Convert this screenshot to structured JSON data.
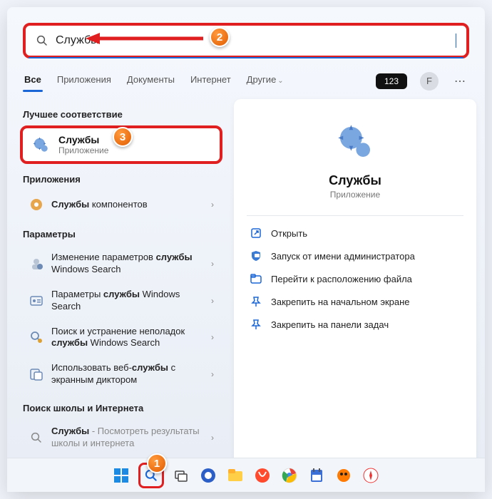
{
  "search": {
    "value": "Службы"
  },
  "tabs": [
    "Все",
    "Приложения",
    "Документы",
    "Интернет",
    "Другие"
  ],
  "active_tab": 0,
  "pill": "123",
  "avatar_initial": "F",
  "sections": {
    "best_match": "Лучшее соответствие",
    "apps": "Приложения",
    "settings": "Параметры",
    "web": "Поиск школы и Интернета"
  },
  "best": {
    "title": "Службы",
    "subtitle": "Приложение"
  },
  "app_items": [
    {
      "prefix": "Службы",
      "rest": " компонентов"
    }
  ],
  "setting_items": [
    {
      "text": "Изменение параметров <b>службы</b> Windows Search"
    },
    {
      "text": "Параметры <b>службы</b> Windows Search"
    },
    {
      "text": "Поиск и устранение неполадок <b>службы</b> Windows Search"
    },
    {
      "text": "Использовать веб-<b>службы</b> с экранным диктором"
    }
  ],
  "web_item": {
    "bold": "Службы",
    "rest": " - Посмотреть результаты школы и интернета"
  },
  "detail": {
    "title": "Службы",
    "subtitle": "Приложение",
    "actions": [
      "Открыть",
      "Запуск от имени администратора",
      "Перейти к расположению файла",
      "Закрепить на начальном экране",
      "Закрепить на панели задач"
    ]
  },
  "badges": {
    "b1": "1",
    "b2": "2",
    "b3": "3"
  }
}
